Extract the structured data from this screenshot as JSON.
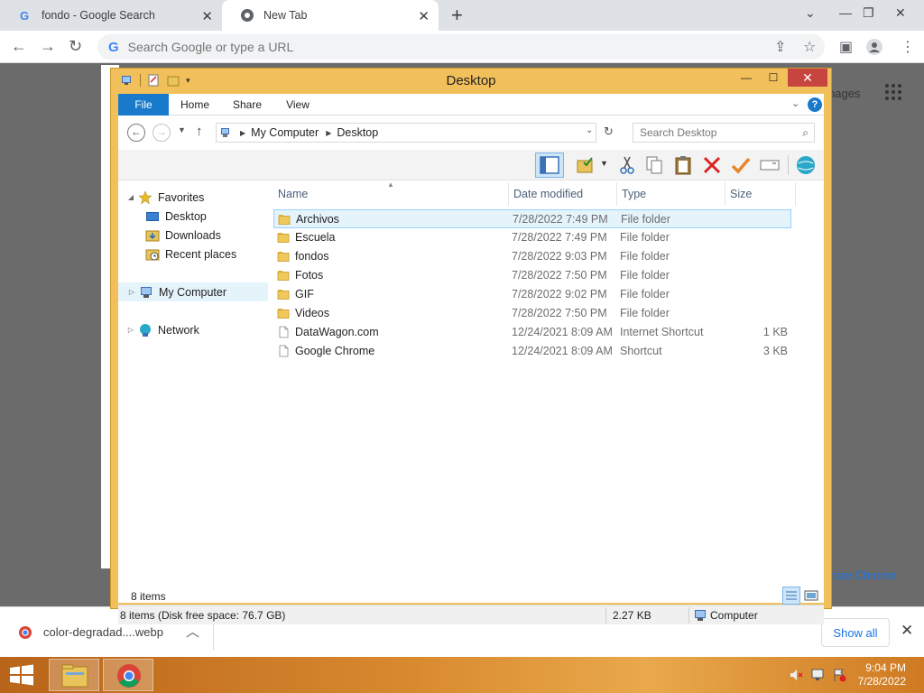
{
  "browser": {
    "tabs": [
      {
        "title": "fondo - Google Search"
      },
      {
        "title": "New Tab"
      }
    ],
    "omnibox_placeholder": "Search Google or type a URL"
  },
  "background_page": {
    "images_text": "nages",
    "customize_text": "nize Chrome"
  },
  "download_bar": {
    "file_name": "color-degradad....webp",
    "show_all_label": "Show all"
  },
  "explorer": {
    "title": "Desktop",
    "ribbon_tabs": [
      "File",
      "Home",
      "Share",
      "View"
    ],
    "breadcrumb": [
      "My Computer",
      "Desktop"
    ],
    "search_placeholder": "Search Desktop",
    "nav_pane": {
      "favorites": "Favorites",
      "favorites_items": [
        "Desktop",
        "Downloads",
        "Recent places"
      ],
      "my_computer": "My Computer",
      "network": "Network"
    },
    "columns": [
      "Name",
      "Date modified",
      "Type",
      "Size"
    ],
    "files": [
      {
        "name": "Archivos",
        "date": "7/28/2022 7:49 PM",
        "type": "File folder",
        "size": "",
        "kind": "folder"
      },
      {
        "name": "Escuela",
        "date": "7/28/2022 7:49 PM",
        "type": "File folder",
        "size": "",
        "kind": "folder"
      },
      {
        "name": "fondos",
        "date": "7/28/2022 9:03 PM",
        "type": "File folder",
        "size": "",
        "kind": "folder"
      },
      {
        "name": "Fotos",
        "date": "7/28/2022 7:50 PM",
        "type": "File folder",
        "size": "",
        "kind": "folder"
      },
      {
        "name": "GIF",
        "date": "7/28/2022 9:02 PM",
        "type": "File folder",
        "size": "",
        "kind": "folder"
      },
      {
        "name": "Videos",
        "date": "7/28/2022 7:50 PM",
        "type": "File folder",
        "size": "",
        "kind": "folder"
      },
      {
        "name": "DataWagon.com",
        "date": "12/24/2021 8:09 AM",
        "type": "Internet Shortcut",
        "size": "1 KB",
        "kind": "file"
      },
      {
        "name": "Google Chrome",
        "date": "12/24/2021 8:09 AM",
        "type": "Shortcut",
        "size": "3 KB",
        "kind": "file"
      }
    ],
    "item_count": "8 items",
    "status": {
      "left": "8 items (Disk free space: 76.7 GB)",
      "size": "2.27 KB",
      "location": "Computer"
    }
  },
  "taskbar": {
    "time": "9:04 PM",
    "date": "7/28/2022"
  },
  "colors": {
    "window_frame": "#f2c05a",
    "file_tab": "#1979ca",
    "close_button": "#c7453f",
    "selection": "#e5f3fb"
  }
}
